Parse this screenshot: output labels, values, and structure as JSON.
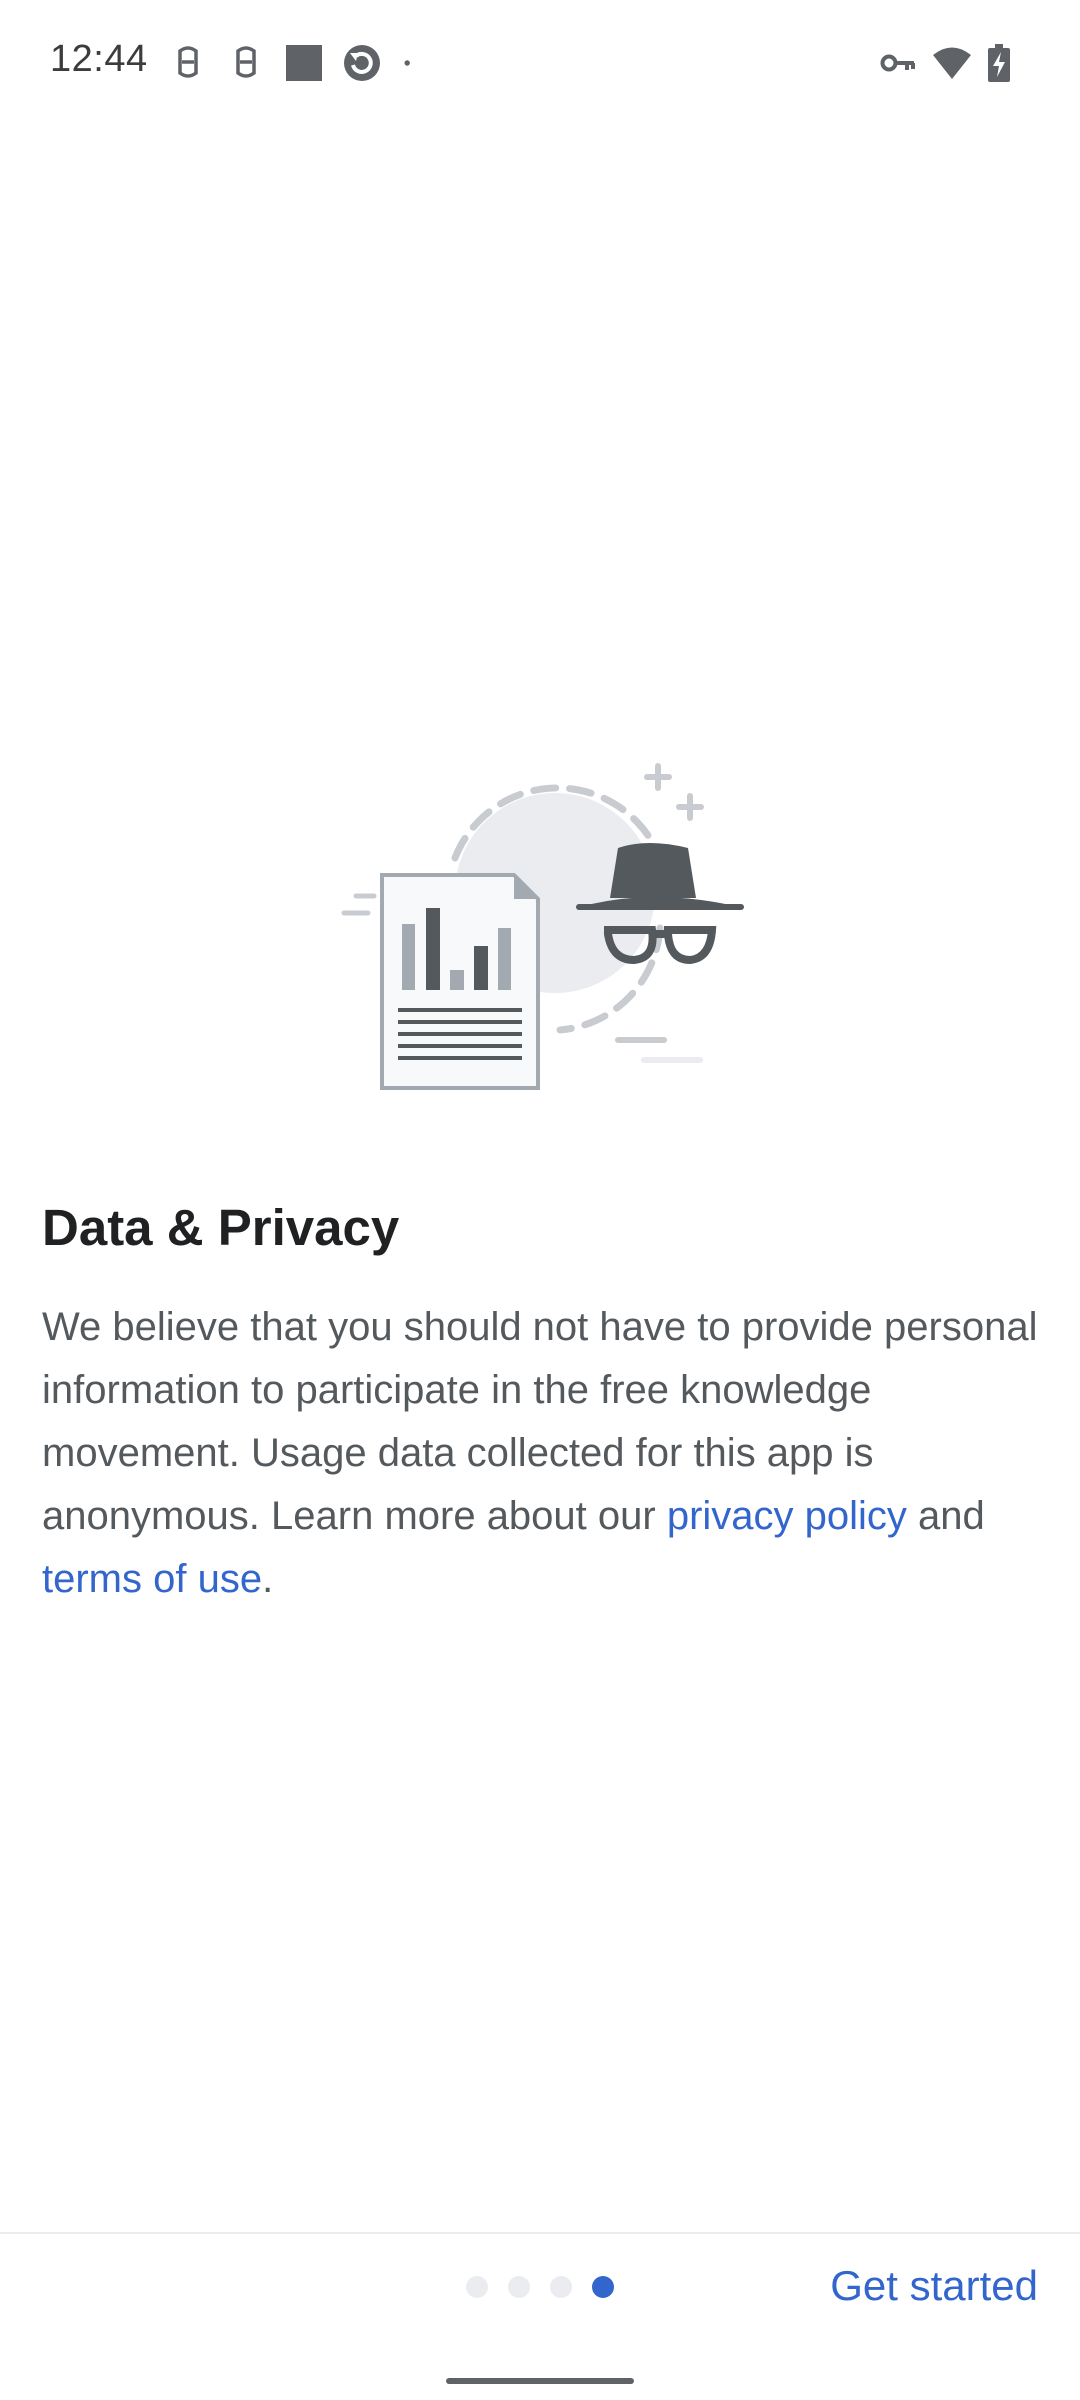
{
  "status_bar": {
    "time": "12:44",
    "left_icons": [
      "notification-face-icon",
      "notification-face-icon",
      "notification-square-icon",
      "notification-refresh-icon",
      "more-notifications-dot-icon"
    ],
    "right_icons": [
      "vpn-key-icon",
      "wifi-icon",
      "battery-charging-icon"
    ]
  },
  "onboarding": {
    "title": "Data & Privacy",
    "body_prefix": "We believe that you should not have to provide personal information to participate in the free knowledge movement. Usage data collected for this app is anonymous. Learn more about our ",
    "privacy_link": "privacy policy",
    "middle_text": " and ",
    "terms_link": "terms of use",
    "suffix": "."
  },
  "pager": {
    "total": 4,
    "current": 4
  },
  "actions": {
    "get_started_label": "Get started"
  },
  "colors": {
    "accent": "#3366cc",
    "title": "#202122",
    "body": "#54595d",
    "inactive_dot": "#eaecf0"
  }
}
